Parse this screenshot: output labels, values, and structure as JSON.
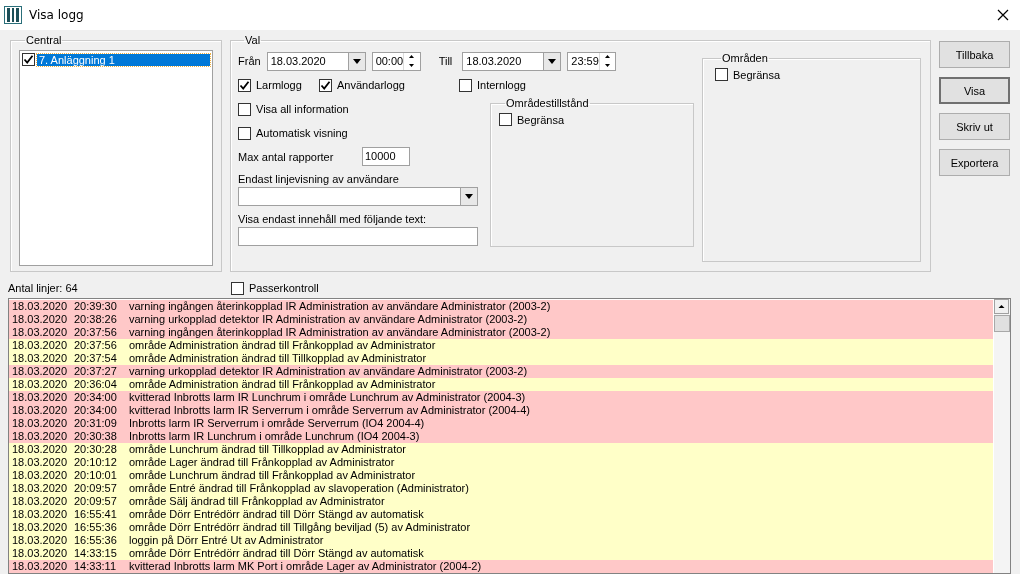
{
  "window": {
    "title": "Visa logg"
  },
  "central": {
    "title": "Central",
    "items": [
      {
        "label": "7. Anläggning 1",
        "checked": true,
        "selected": true
      }
    ]
  },
  "val": {
    "title": "Val",
    "from_label": "Från",
    "from_date": "18.03.2020",
    "from_time": "00:00",
    "to_label": "Till",
    "to_date": "18.03.2020",
    "to_time": "23:59",
    "log_types": [
      {
        "label": "Larmlogg",
        "checked": true
      },
      {
        "label": "Användarlogg",
        "checked": true
      },
      {
        "label": "Internlogg",
        "checked": false
      }
    ],
    "options": [
      {
        "label": "Visa all information",
        "checked": false
      },
      {
        "label": "Automatisk visning",
        "checked": false
      }
    ],
    "max_label": "Max antal rapporter",
    "max_value": "10000",
    "user_label": "Endast linjevisning av användare",
    "text_label": "Visa endast innehåll med följande text:",
    "area_state": {
      "title": "Områdestillstånd",
      "limit_label": "Begränsa",
      "limit_checked": false
    },
    "areas": {
      "title": "Områden",
      "limit_label": "Begränsa",
      "limit_checked": false
    }
  },
  "buttons": [
    {
      "label": "Tillbaka",
      "default": false
    },
    {
      "label": "Visa",
      "default": true
    },
    {
      "label": "Skriv ut",
      "default": false
    },
    {
      "label": "Exportera",
      "default": false
    }
  ],
  "line_count": "Antal linjer: 64",
  "passerkontroll": {
    "label": "Passerkontroll",
    "checked": false
  },
  "log": [
    {
      "date": "18.03.2020",
      "time": "20:39:30",
      "message": "varning ingången återinkopplad IR Administration av användare Administrator (2003-2)",
      "kind": "alarm"
    },
    {
      "date": "18.03.2020",
      "time": "20:38:26",
      "message": "varning urkopplad detektor IR Administration av användare Administrator (2003-2)",
      "kind": "alarm"
    },
    {
      "date": "18.03.2020",
      "time": "20:37:56",
      "message": "varning ingången återinkopplad IR Administration av användare Administrator (2003-2)",
      "kind": "alarm"
    },
    {
      "date": "18.03.2020",
      "time": "20:37:56",
      "message": "område Administration ändrad till Frånkopplad av Administrator",
      "kind": "event"
    },
    {
      "date": "18.03.2020",
      "time": "20:37:54",
      "message": "område Administration ändrad till Tillkopplad av Administrator",
      "kind": "event"
    },
    {
      "date": "18.03.2020",
      "time": "20:37:27",
      "message": "varning urkopplad detektor IR Administration av användare Administrator (2003-2)",
      "kind": "alarm"
    },
    {
      "date": "18.03.2020",
      "time": "20:36:04",
      "message": "område Administration ändrad till Frånkopplad av Administrator",
      "kind": "event"
    },
    {
      "date": "18.03.2020",
      "time": "20:34:00",
      "message": "kvitterad Inbrotts larm IR Lunchrum i område Lunchrum av Administrator (2004-3)",
      "kind": "alarm"
    },
    {
      "date": "18.03.2020",
      "time": "20:34:00",
      "message": "kvitterad Inbrotts larm IR Serverrum i område Serverrum av Administrator (2004-4)",
      "kind": "alarm"
    },
    {
      "date": "18.03.2020",
      "time": "20:31:09",
      "message": "Inbrotts larm IR Serverrum i område Serverrum (IO4 2004-4)",
      "kind": "alarm"
    },
    {
      "date": "18.03.2020",
      "time": "20:30:38",
      "message": "Inbrotts larm IR Lunchrum i område Lunchrum (IO4 2004-3)",
      "kind": "alarm"
    },
    {
      "date": "18.03.2020",
      "time": "20:30:28",
      "message": "område Lunchrum ändrad till Tillkopplad av Administrator",
      "kind": "event"
    },
    {
      "date": "18.03.2020",
      "time": "20:10:12",
      "message": "område Lager ändrad till Frånkopplad av Administrator",
      "kind": "event"
    },
    {
      "date": "18.03.2020",
      "time": "20:10:01",
      "message": "område Lunchrum ändrad till Frånkopplad av Administrator",
      "kind": "event"
    },
    {
      "date": "18.03.2020",
      "time": "20:09:57",
      "message": "område Entré ändrad till Frånkopplad av slavoperation (Administrator)",
      "kind": "event"
    },
    {
      "date": "18.03.2020",
      "time": "20:09:57",
      "message": "område Sälj ändrad till Frånkopplad av Administrator",
      "kind": "event"
    },
    {
      "date": "18.03.2020",
      "time": "16:55:41",
      "message": "område Dörr Entrédörr ändrad till Dörr Stängd av automatisk",
      "kind": "event"
    },
    {
      "date": "18.03.2020",
      "time": "16:55:36",
      "message": "område Dörr Entrédörr ändrad till Tillgång beviljad (5) av Administrator",
      "kind": "event"
    },
    {
      "date": "18.03.2020",
      "time": "16:55:36",
      "message": "loggin på Dörr Entré Ut av Administrator",
      "kind": "event"
    },
    {
      "date": "18.03.2020",
      "time": "14:33:15",
      "message": "område Dörr Entrédörr ändrad till Dörr Stängd av automatisk",
      "kind": "event"
    },
    {
      "date": "18.03.2020",
      "time": "14:33:11",
      "message": "kvitterad Inbrotts larm MK Port i område Lager av Administrator (2004-2)",
      "kind": "alarm"
    }
  ]
}
